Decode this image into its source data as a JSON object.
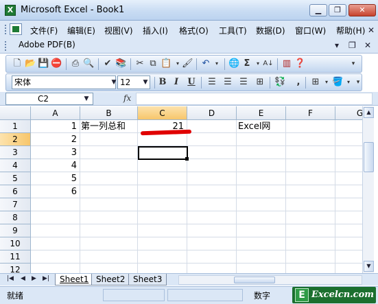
{
  "window": {
    "title": "Microsoft Excel - Book1"
  },
  "menu": {
    "items": [
      "文件(F)",
      "编辑(E)",
      "视图(V)",
      "插入(I)",
      "格式(O)",
      "工具(T)",
      "数据(D)",
      "窗口(W)",
      "帮助(H)"
    ],
    "adobe": "Adobe PDF(B)"
  },
  "toolbar": {
    "font_name": "宋体",
    "font_size": "12",
    "bold": "B",
    "italic": "I",
    "underline": "U",
    "sum": "Σ"
  },
  "formula_bar": {
    "name_box": "C2",
    "fx": "fx",
    "content": ""
  },
  "grid": {
    "columns": [
      "A",
      "B",
      "C",
      "D",
      "E",
      "F",
      "G"
    ],
    "rows": [
      "1",
      "2",
      "3",
      "4",
      "5",
      "6",
      "7",
      "8",
      "9",
      "10",
      "11",
      "12"
    ],
    "selected_column": "C",
    "selected_row": "2",
    "cells": {
      "A1": "1",
      "A2": "2",
      "A3": "3",
      "A4": "4",
      "A5": "5",
      "A6": "6",
      "B1": "第一列总和",
      "C1": "21",
      "E1": "Excel网"
    }
  },
  "sheets": [
    "Sheet1",
    "Sheet2",
    "Sheet3"
  ],
  "active_sheet": "Sheet1",
  "status": {
    "text": "就绪",
    "numlock": "数字"
  },
  "watermark": {
    "logo": "E",
    "text": "Excelcn.com"
  },
  "colors": {
    "selection_header": "#f7c66b",
    "annotation_red": "#e00000",
    "title_gradient": "#c9dcf3"
  }
}
